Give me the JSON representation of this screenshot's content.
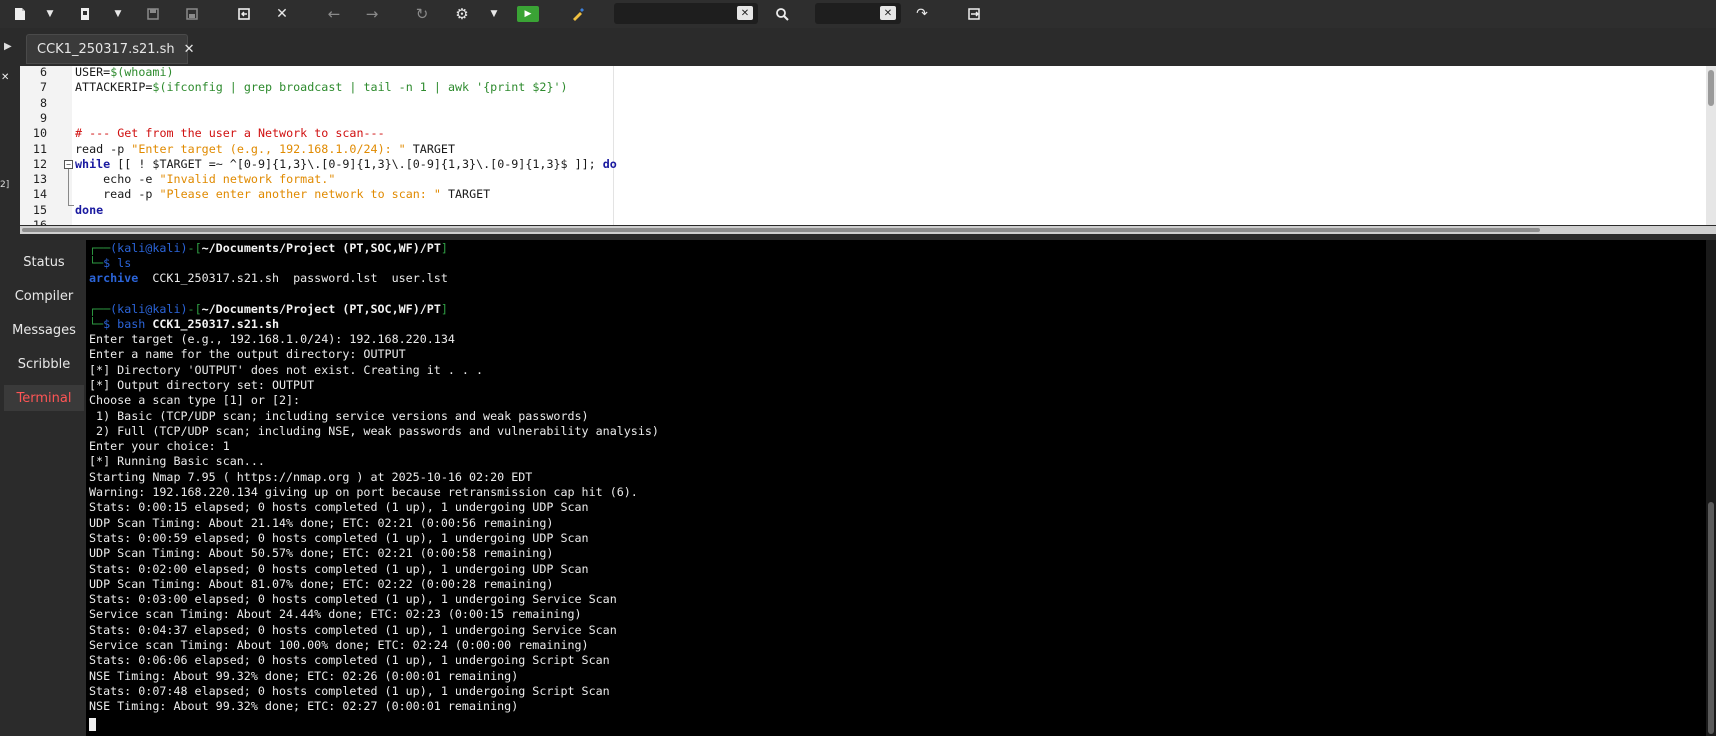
{
  "toolbar": {
    "icons": [
      "new-file-icon",
      "open-file-icon",
      "save-icon",
      "save-all-icon",
      "revert-icon",
      "close-icon",
      "back-icon",
      "forward-icon",
      "reload-icon",
      "preferences-icon",
      "run-icon",
      "color-picker-icon",
      "clear-icon",
      "search-icon",
      "clear-icon",
      "jump-to-line-icon",
      "quit-icon"
    ],
    "search_value": "",
    "goto_value": ""
  },
  "tab": {
    "label": "CCK1_250317.s21.sh",
    "close": "✕"
  },
  "left_strip": {
    "mark": "✕",
    "num": "2]"
  },
  "editor": {
    "lines": [
      {
        "n": "6",
        "parts": [
          [
            "USER=",
            ""
          ],
          [
            "$(whoami)",
            "grn"
          ]
        ]
      },
      {
        "n": "7",
        "parts": [
          [
            "ATTACKERIP=",
            ""
          ],
          [
            "$(ifconfig | grep broadcast | tail -n 1 | awk '{print $2}')",
            "grn"
          ]
        ]
      },
      {
        "n": "8",
        "parts": []
      },
      {
        "n": "9",
        "parts": []
      },
      {
        "n": "10",
        "parts": [
          [
            "# --- Get from the user a Network to scan---",
            "cmt"
          ]
        ]
      },
      {
        "n": "11",
        "parts": [
          [
            "read -p ",
            ""
          ],
          [
            "\"Enter target (e.g., 192.168.1.0/24): \"",
            "str"
          ],
          [
            " TARGET",
            ""
          ]
        ]
      },
      {
        "n": "12",
        "parts": [
          [
            "while",
            "kw"
          ],
          [
            " [[ ! $TARGET =~ ^[0-9]{1,3}\\.[0-9]{1,3}\\.[0-9]{1,3}\\.[0-9]{1,3}$ ]]; ",
            ""
          ],
          [
            "do",
            "kw"
          ]
        ]
      },
      {
        "n": "13",
        "parts": [
          [
            "    echo -e ",
            ""
          ],
          [
            "\"Invalid network format.\"",
            "str"
          ]
        ]
      },
      {
        "n": "14",
        "parts": [
          [
            "    read -p ",
            ""
          ],
          [
            "\"Please enter another network to scan: \"",
            "str"
          ],
          [
            " TARGET",
            ""
          ]
        ]
      },
      {
        "n": "15",
        "parts": [
          [
            "done",
            "kw"
          ]
        ]
      },
      {
        "n": "16",
        "parts": []
      }
    ]
  },
  "side_panel": {
    "items": [
      "Status",
      "Compiler",
      "Messages",
      "Scribble",
      "Terminal"
    ]
  },
  "terminal": {
    "prompt1": {
      "user_host": "(kali@kali)",
      "dash": "-[",
      "path": "~/Documents/Project (PT,SOC,WF)/PT",
      "close": "]",
      "cmd": "ls"
    },
    "ls_output": {
      "dir": "archive",
      "files": "  CCK1_250317.s21.sh  password.lst  user.lst"
    },
    "prompt2": {
      "user_host": "(kali@kali)",
      "dash": "-[",
      "path": "~/Documents/Project (PT,SOC,WF)/PT",
      "close": "]",
      "cmd": "bash",
      "arg": "CCK1_250317.s21.sh"
    },
    "lines": [
      "Enter target (e.g., 192.168.1.0/24): 192.168.220.134",
      "Enter a name for the output directory: OUTPUT",
      "[*] Directory 'OUTPUT' does not exist. Creating it . . .",
      "[*] Output directory set: OUTPUT",
      "Choose a scan type [1] or [2]:",
      " 1) Basic (TCP/UDP scan; including service versions and weak passwords)",
      " 2) Full (TCP/UDP scan; including NSE, weak passwords and vulnerability analysis)",
      "Enter your choice: 1",
      "[*] Running Basic scan...",
      "Starting Nmap 7.95 ( https://nmap.org ) at 2025-10-16 02:20 EDT",
      "Warning: 192.168.220.134 giving up on port because retransmission cap hit (6).",
      "Stats: 0:00:15 elapsed; 0 hosts completed (1 up), 1 undergoing UDP Scan",
      "UDP Scan Timing: About 21.14% done; ETC: 02:21 (0:00:56 remaining)",
      "Stats: 0:00:59 elapsed; 0 hosts completed (1 up), 1 undergoing UDP Scan",
      "UDP Scan Timing: About 50.57% done; ETC: 02:21 (0:00:58 remaining)",
      "Stats: 0:02:00 elapsed; 0 hosts completed (1 up), 1 undergoing UDP Scan",
      "UDP Scan Timing: About 81.07% done; ETC: 02:22 (0:00:28 remaining)",
      "Stats: 0:03:00 elapsed; 0 hosts completed (1 up), 1 undergoing Service Scan",
      "Service scan Timing: About 24.44% done; ETC: 02:23 (0:00:15 remaining)",
      "Stats: 0:04:37 elapsed; 0 hosts completed (1 up), 1 undergoing Service Scan",
      "Service scan Timing: About 100.00% done; ETC: 02:24 (0:00:00 remaining)",
      "Stats: 0:06:06 elapsed; 0 hosts completed (1 up), 1 undergoing Script Scan",
      "NSE Timing: About 99.32% done; ETC: 02:26 (0:00:01 remaining)",
      "Stats: 0:07:48 elapsed; 0 hosts completed (1 up), 1 undergoing Script Scan",
      "NSE Timing: About 99.32% done; ETC: 02:27 (0:00:01 remaining)"
    ]
  },
  "colors": {
    "prompt_green": "#2f9e44",
    "prompt_blue": "#2b64d8",
    "active_red": "#ff5555",
    "string_orange": "#e08a00",
    "comment_red": "#d01010"
  }
}
